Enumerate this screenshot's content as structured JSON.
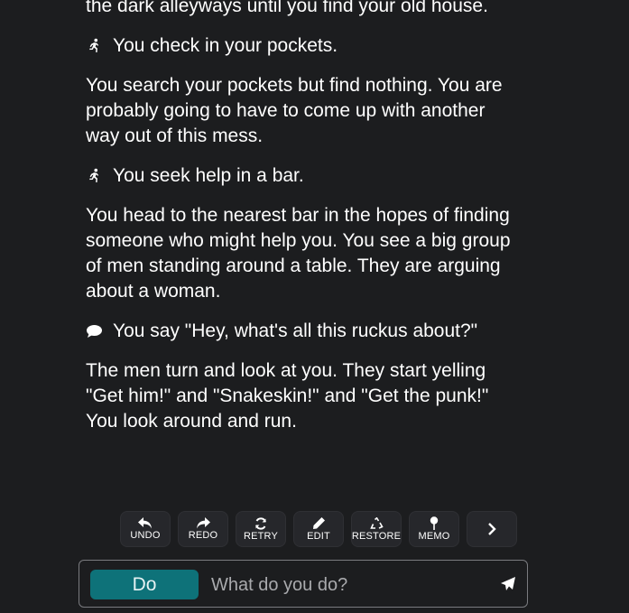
{
  "story": {
    "intro_tail": "the dark alleyways until you find your old house.",
    "actions": [
      {
        "icon": "running-person-icon",
        "text": "You check in your pockets.",
        "response": "You search your pockets but find nothing. You are probably going to have to come up with another way out of this mess."
      },
      {
        "icon": "running-person-icon",
        "text": "You seek help in a bar.",
        "response": "You head to the nearest bar in the hopes of finding someone who might help you. You see a big group of men standing around a table. They are arguing about a woman."
      },
      {
        "icon": "speech-bubble-icon",
        "text": "You say \"Hey, what's all this ruckus about?\"",
        "response": "The men turn and look at you. They start yelling \"Get him!\" and \"Snakeskin!\" and \"Get the punk!\"",
        "response_extra": "You look around and run."
      }
    ]
  },
  "toolbar": {
    "undo": "UNDO",
    "redo": "REDO",
    "retry": "RETRY",
    "edit": "EDIT",
    "restore": "RESTORE",
    "memo": "MEMO"
  },
  "input": {
    "mode_label": "Do",
    "placeholder": "What do you do?"
  },
  "colors": {
    "background": "#1c1d1f",
    "accent": "#0e7279",
    "button_bg": "#26272b"
  }
}
